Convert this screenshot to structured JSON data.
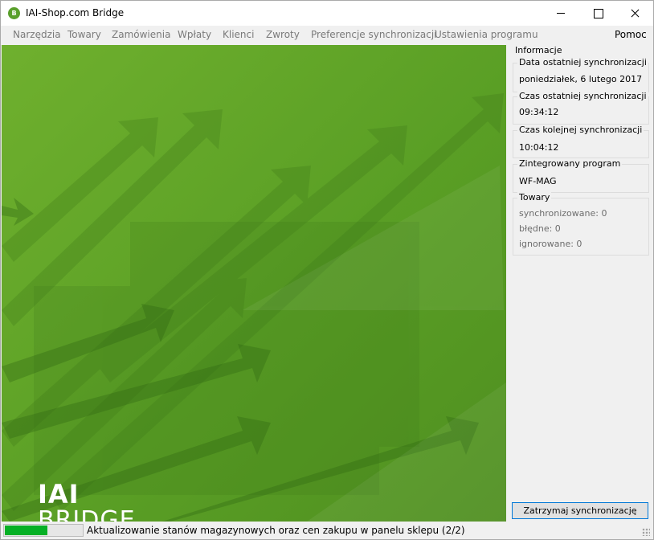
{
  "window": {
    "title": "IAI-Shop.com Bridge",
    "icon_glyph": "B"
  },
  "menu": {
    "items": [
      "Narzędzia",
      "Towary",
      "Zamówienia",
      "Wpłaty",
      "Klienci",
      "Zwroty",
      "Preferencje synchronizacji",
      "Ustawienia programu"
    ],
    "help": "Pomoc"
  },
  "banner": {
    "logo_line1": "IAI",
    "logo_line2": "BRIDGE",
    "color": "#5fa52a"
  },
  "info": {
    "legend": "Informacje",
    "last_sync_date": {
      "label": "Data ostatniej synchronizacji",
      "value": "poniedziałek, 6 lutego 2017"
    },
    "last_sync_time": {
      "label": "Czas ostatniej synchronizacji",
      "value": "09:34:12"
    },
    "next_sync_time": {
      "label": "Czas kolejnej synchronizacji",
      "value": "10:04:12"
    },
    "integrated_program": {
      "label": "Zintegrowany program",
      "value": "WF-MAG"
    },
    "products": {
      "label": "Towary",
      "synchronized": "synchronizowane: 0",
      "errors": "błędne: 0",
      "ignored": "ignorowane: 0"
    }
  },
  "buttons": {
    "stop_sync": "Zatrzymaj synchronizację"
  },
  "status": {
    "progress_percent": 55,
    "progress_color": "#06b025",
    "text": "Aktualizowanie stanów magazynowych oraz cen zakupu w panelu sklepu (2/2)"
  }
}
